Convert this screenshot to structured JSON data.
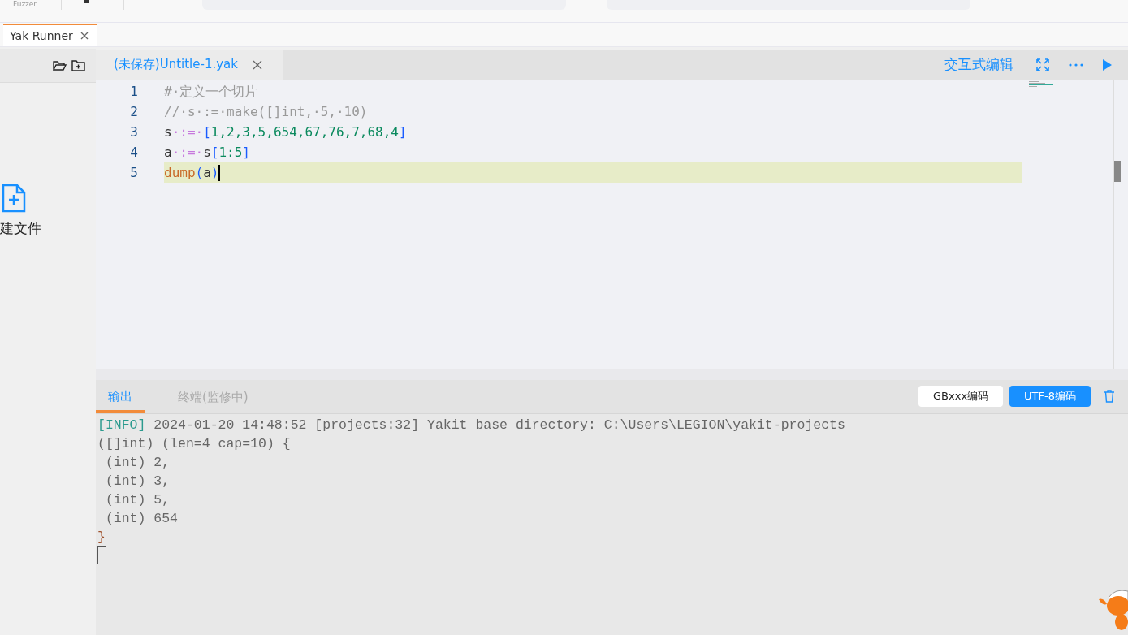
{
  "top_bar": {
    "label": "Fuzzer"
  },
  "app_tabs": [
    {
      "label": "Yak Runner",
      "selected": true
    }
  ],
  "sidebar": {
    "new_file_label": "建文件"
  },
  "editor": {
    "file_tabs": [
      {
        "label": "(未保存)Untitle-1.yak",
        "selected": true
      }
    ],
    "mode_label": "交互式编辑",
    "lines": [
      {
        "number": "1",
        "active": false,
        "tokens": [
          {
            "text": "#·定义一个切片",
            "kind": "comment"
          }
        ]
      },
      {
        "number": "2",
        "active": false,
        "tokens": [
          {
            "text": "//·s·:=·make([]int,·5,·10)",
            "kind": "comment"
          }
        ]
      },
      {
        "number": "3",
        "active": false,
        "tokens": [
          {
            "text": "s",
            "kind": "plain"
          },
          {
            "text": "·:=·",
            "kind": "op"
          },
          {
            "text": "[",
            "kind": "bracket"
          },
          {
            "text": "1,2,3,5,654,67,76,7,68,4",
            "kind": "number"
          },
          {
            "text": "]",
            "kind": "bracket"
          }
        ]
      },
      {
        "number": "4",
        "active": false,
        "tokens": [
          {
            "text": "a",
            "kind": "plain"
          },
          {
            "text": "·:=·",
            "kind": "op"
          },
          {
            "text": "s",
            "kind": "plain"
          },
          {
            "text": "[",
            "kind": "bracket"
          },
          {
            "text": "1:5",
            "kind": "number"
          },
          {
            "text": "]",
            "kind": "bracket"
          }
        ]
      },
      {
        "number": "5",
        "active": true,
        "tokens": [
          {
            "text": "dump",
            "kind": "func"
          },
          {
            "text": "(",
            "kind": "bracket"
          },
          {
            "text": "a",
            "kind": "plain"
          },
          {
            "text": ")",
            "kind": "bracket"
          }
        ]
      }
    ]
  },
  "output": {
    "tabs": [
      {
        "label": "输出",
        "selected": true
      },
      {
        "label": "终端(监修中)",
        "selected": false
      }
    ],
    "encodings": [
      {
        "label": "GBxxx编码",
        "selected": false
      },
      {
        "label": "UTF-8编码",
        "selected": true
      }
    ],
    "lines": [
      {
        "tokens": [
          {
            "text": "[INFO]",
            "kind": "info"
          },
          {
            "text": " 2024-01-20 14:48:52 [projects:32] Yakit base directory: C:\\Users\\LEGION\\yakit-projects",
            "kind": "plain"
          }
        ]
      },
      {
        "tokens": [
          {
            "text": "([]int) (len=4 cap=10) {",
            "kind": "plain"
          }
        ]
      },
      {
        "tokens": [
          {
            "text": " (int) 2,",
            "kind": "plain"
          }
        ]
      },
      {
        "tokens": [
          {
            "text": " (int) 3,",
            "kind": "plain"
          }
        ]
      },
      {
        "tokens": [
          {
            "text": " (int) 5,",
            "kind": "plain"
          }
        ]
      },
      {
        "tokens": [
          {
            "text": " (int) 654",
            "kind": "plain"
          }
        ]
      },
      {
        "tokens": [
          {
            "text": "}",
            "kind": "brace"
          }
        ]
      }
    ]
  }
}
